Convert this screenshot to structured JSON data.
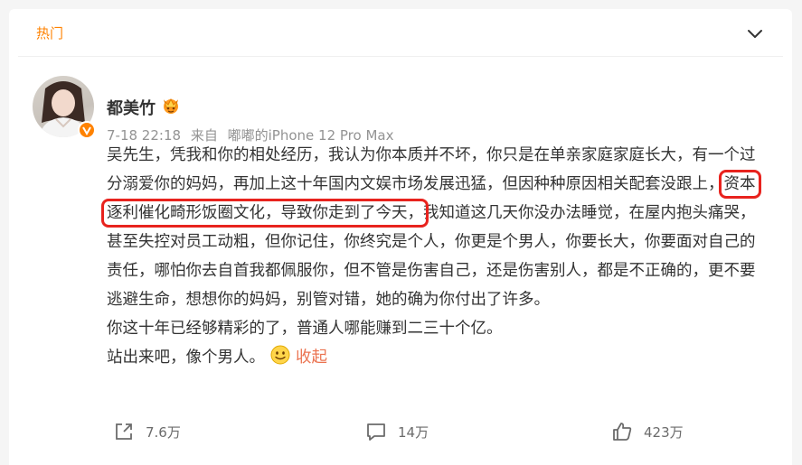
{
  "header": {
    "hot_label": "热门"
  },
  "post": {
    "author": "都美竹",
    "time": "7-18 22:18",
    "source_prefix": "来自",
    "source_device": "嘟嘟的iPhone 12 Pro Max",
    "text": {
      "seg1": "吴先生，凭我和你的相处经历，我认为你本质并不坏，你只是在单亲家庭家庭长大，有一个过分溺爱你的妈妈，再加上这十年国内文娱市场发展迅猛，但因种种原因相关配套没跟上，",
      "highlight": "资本逐利催化畸形饭圈文化，导致你走到了今天，",
      "seg2": "我知道这几天你没办法睡觉，在屋内抱头痛哭，甚至失控对员工动粗，但你记住，你终究是个人，你更是个男人，你要长大，你要面对自己的责任，哪怕你去自首我都佩服你，但不管是伤害自己，还是伤害别人，都是不正确的，更不要逃避生命，想想你的妈妈，别管对错，她的确为你付出了许多。",
      "line2": "你这十年已经够精彩的了，普通人哪能赚到二三十个亿。",
      "line3": "站出来吧，像个男人。"
    },
    "fold_label": "收起"
  },
  "actions": {
    "share": "7.6万",
    "comment": "14万",
    "like": "423万"
  },
  "colors": {
    "accent": "#ff8200",
    "highlight_border": "#e8231e",
    "link": "#eb7350"
  },
  "icons": [
    "chevron-down-icon",
    "vip-crown-icon",
    "verified-badge-icon",
    "smile-emoji-icon",
    "share-icon",
    "comment-icon",
    "like-icon"
  ]
}
